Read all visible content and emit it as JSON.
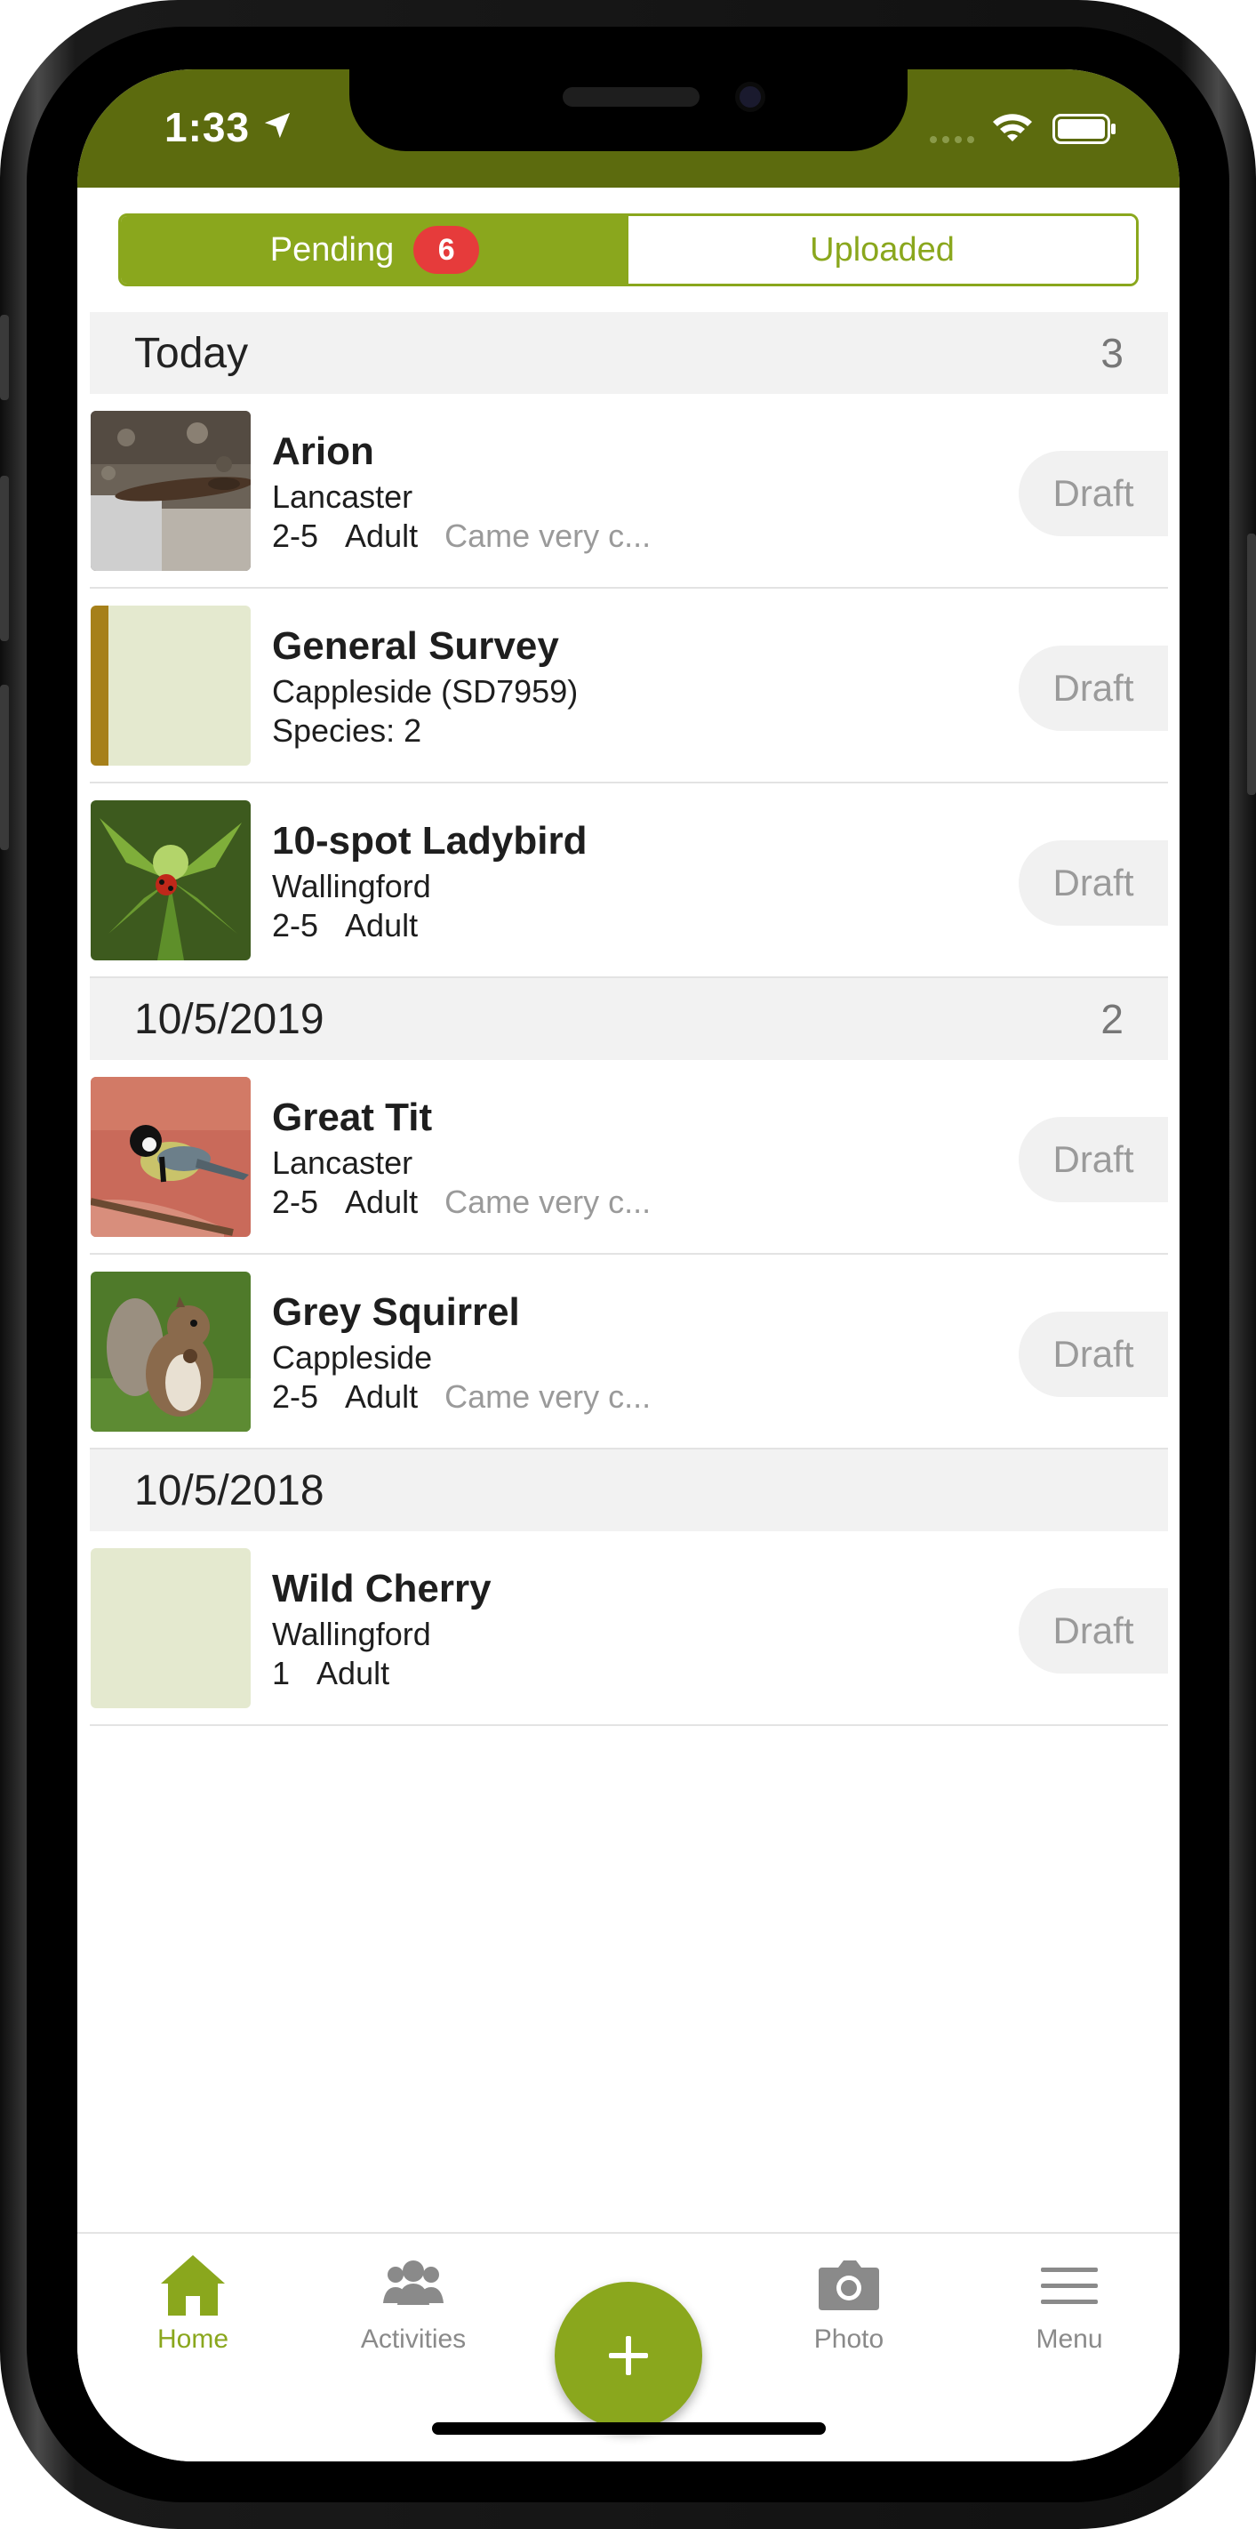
{
  "status_bar": {
    "time": "1:33"
  },
  "segment": {
    "pending_label": "Pending",
    "pending_count": "6",
    "uploaded_label": "Uploaded"
  },
  "groups": [
    {
      "date": "Today",
      "count": "3",
      "items": [
        {
          "title": "Arion",
          "location": "Lancaster",
          "number": "2-5",
          "stage": "Adult",
          "comment": "Came very c...",
          "status": "Draft"
        },
        {
          "title": "General Survey",
          "location": "Cappleside (SD7959)",
          "species": "Species: 2",
          "status": "Draft"
        },
        {
          "title": "10-spot Ladybird",
          "location": "Wallingford",
          "number": "2-5",
          "stage": "Adult",
          "status": "Draft"
        }
      ]
    },
    {
      "date": "10/5/2019",
      "count": "2",
      "items": [
        {
          "title": "Great Tit",
          "location": "Lancaster",
          "number": "2-5",
          "stage": "Adult",
          "comment": "Came very c...",
          "status": "Draft"
        },
        {
          "title": "Grey Squirrel",
          "location": "Cappleside",
          "number": "2-5",
          "stage": "Adult",
          "comment": "Came very c...",
          "status": "Draft"
        }
      ]
    },
    {
      "date": "10/5/2018",
      "items": [
        {
          "title": "Wild Cherry",
          "location": "Wallingford",
          "number": "1",
          "stage": "Adult",
          "status": "Draft"
        }
      ]
    }
  ],
  "tabs": {
    "home": "Home",
    "activities": "Activities",
    "photo": "Photo",
    "menu": "Menu"
  },
  "colors": {
    "brand": "#8aa71d",
    "status_bar": "#5c6b0e",
    "badge": "#e63b3b"
  }
}
